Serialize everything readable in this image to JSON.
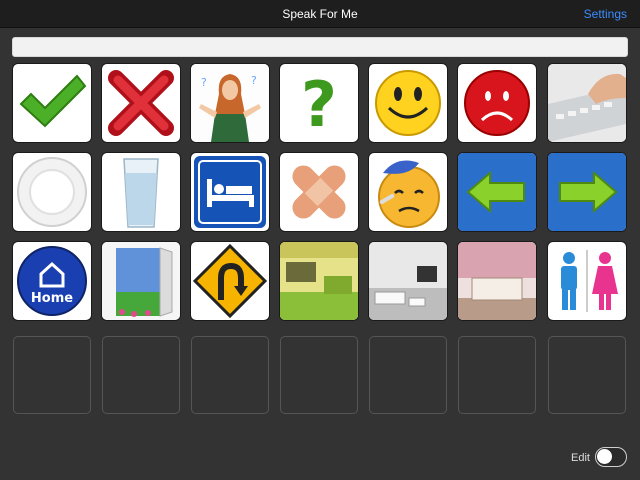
{
  "navbar": {
    "title": "Speak For Me",
    "settings_label": "Settings"
  },
  "speech_bar": {
    "text": ""
  },
  "tiles": [
    {
      "icon": "checkmark-icon"
    },
    {
      "icon": "red-x-icon"
    },
    {
      "icon": "confused-woman-icon"
    },
    {
      "icon": "question-mark-icon"
    },
    {
      "icon": "happy-face-icon"
    },
    {
      "icon": "sad-face-icon"
    },
    {
      "icon": "keyboard-typing-icon"
    },
    {
      "icon": "plate-icon"
    },
    {
      "icon": "glass-of-water-icon"
    },
    {
      "icon": "bed-sign-icon"
    },
    {
      "icon": "bandage-icon"
    },
    {
      "icon": "sick-face-icon"
    },
    {
      "icon": "left-arrow-icon"
    },
    {
      "icon": "right-arrow-icon"
    },
    {
      "icon": "home-button-icon",
      "label": "Home"
    },
    {
      "icon": "open-door-icon"
    },
    {
      "icon": "u-turn-sign-icon"
    },
    {
      "icon": "kitchen-icon"
    },
    {
      "icon": "living-room-icon"
    },
    {
      "icon": "bedroom-icon"
    },
    {
      "icon": "restroom-sign-icon"
    }
  ],
  "empty_tile_count": 7,
  "footer": {
    "edit_label": "Edit",
    "edit_enabled": false
  },
  "colors": {
    "accent": "#3b8cff",
    "background": "#333333",
    "navbar": "#1e1e1e"
  }
}
